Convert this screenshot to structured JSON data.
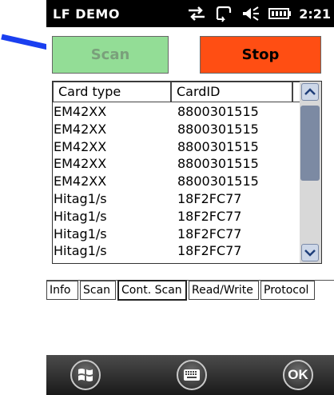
{
  "status_bar": {
    "app_title": "LF DEMO",
    "time": "2:21"
  },
  "buttons": {
    "scan_label": "Scan",
    "stop_label": "Stop"
  },
  "list": {
    "columns": [
      "Card type",
      "CardID"
    ],
    "rows": [
      [
        "EM42XX",
        "8800301515"
      ],
      [
        "EM42XX",
        "8800301515"
      ],
      [
        "EM42XX",
        "8800301515"
      ],
      [
        "EM42XX",
        "8800301515"
      ],
      [
        "EM42XX",
        "8800301515"
      ],
      [
        "Hitag1/s",
        "18F2FC77"
      ],
      [
        "Hitag1/s",
        "18F2FC77"
      ],
      [
        "Hitag1/s",
        "18F2FC77"
      ],
      [
        "Hitag1/s",
        "18F2FC77"
      ]
    ]
  },
  "tabs": [
    "Info",
    "Scan",
    "Cont. Scan",
    "Read/Write",
    "Protocol"
  ],
  "nav": {
    "ok_label": "OK"
  },
  "colors": {
    "scan_bg": "#93dd96",
    "stop_bg": "#ff4e13",
    "arrow": "#1a3ff0"
  },
  "icons": [
    "connection-icon",
    "sync-icon",
    "volume-icon",
    "battery-icon",
    "windows-start-icon",
    "keyboard-icon"
  ]
}
